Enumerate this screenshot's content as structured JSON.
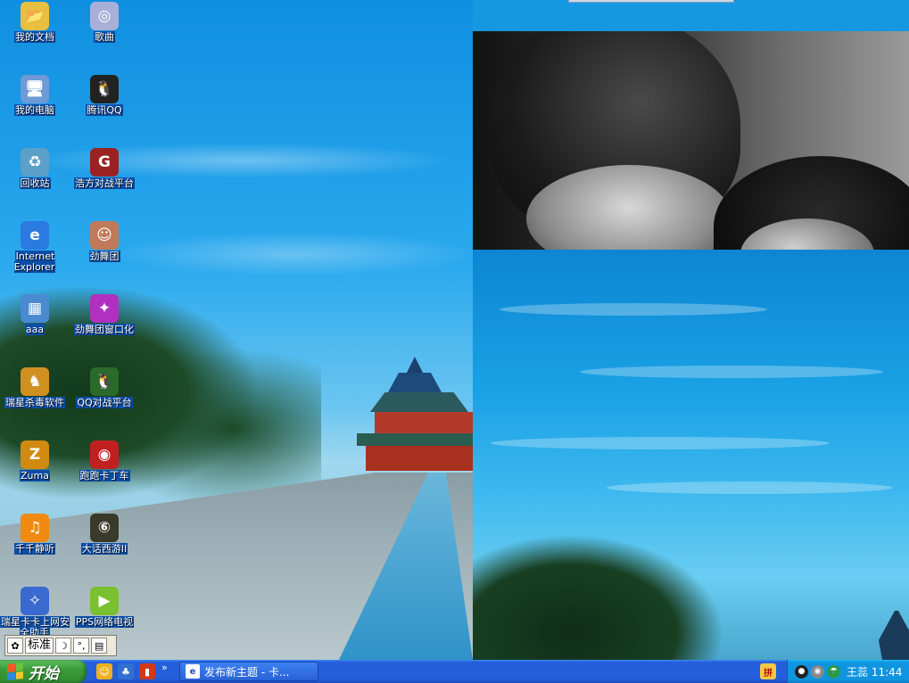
{
  "desktop": {
    "icons": [
      {
        "label": "我的文档",
        "glyph": "📂",
        "icon": "folder-icon",
        "color": "#e8c040"
      },
      {
        "label": "歌曲",
        "glyph": "◎",
        "icon": "cd-icon",
        "color": "#a8b0d8"
      },
      {
        "label": "我的电脑",
        "glyph": "🖥",
        "icon": "computer-icon",
        "color": "#6e9ad6"
      },
      {
        "label": "腾讯QQ",
        "glyph": "🐧",
        "icon": "qq-penguin-icon",
        "color": "#222222"
      },
      {
        "label": "回收站",
        "glyph": "♻",
        "icon": "recycle-bin-icon",
        "color": "#5aa0c8"
      },
      {
        "label": "浩方对战平台",
        "glyph": "G",
        "icon": "game-icon",
        "color": "#9a2222"
      },
      {
        "label": "Internet Explorer",
        "glyph": "e",
        "icon": "internet-explorer-icon",
        "color": "#2a7ae0"
      },
      {
        "label": "劲舞团",
        "glyph": "☺",
        "icon": "dance-game-avatar-icon",
        "color": "#c07a5a"
      },
      {
        "label": "aaa",
        "glyph": "▦",
        "icon": "network-computer-icon",
        "color": "#4a8ad0"
      },
      {
        "label": "劲舞团窗口化",
        "glyph": "✦",
        "icon": "dance-window-icon",
        "color": "#b030c0"
      },
      {
        "label": "瑞星杀毒软件",
        "glyph": "♞",
        "icon": "antivirus-lion-icon",
        "color": "#d09020"
      },
      {
        "label": "QQ对战平台",
        "glyph": "🐧",
        "icon": "qq-game-icon",
        "color": "#2a6a2a"
      },
      {
        "label": "Zuma",
        "glyph": "Z",
        "icon": "zuma-icon",
        "color": "#d08a10"
      },
      {
        "label": "跑跑卡丁车",
        "glyph": "◉",
        "icon": "kart-icon",
        "color": "#c02020"
      },
      {
        "label": "千千静听",
        "glyph": "♫",
        "icon": "music-player-icon",
        "color": "#f08a10"
      },
      {
        "label": "大话西游II",
        "glyph": "⑥",
        "icon": "game-disc-icon",
        "color": "#3a3a2a"
      },
      {
        "label": "瑞星卡卡上网安全助手",
        "glyph": "✧",
        "icon": "security-wizard-icon",
        "color": "#3a6ad0"
      },
      {
        "label": "PPS网络电视",
        "glyph": "▶",
        "icon": "pps-tv-icon",
        "color": "#7ac030"
      }
    ]
  },
  "langbar": {
    "mode_label": "标准",
    "icons": [
      "ime-logo-icon",
      "moon-icon",
      "punctuation-icon",
      "keyboard-icon"
    ]
  },
  "taskbar": {
    "start_label": "开始",
    "quicklaunch": [
      {
        "icon": "qq-quicklaunch-icon",
        "color": "#f0b020",
        "glyph": "☺"
      },
      {
        "icon": "qq-game-quicklaunch-icon",
        "color": "#3070d0",
        "glyph": "♣"
      },
      {
        "icon": "app-quicklaunch-icon",
        "color": "#d03a1a",
        "glyph": "▮"
      }
    ],
    "chevron": "»",
    "task_label": "发布新主题 - 卡...",
    "clock": "王蕊 11:44"
  },
  "colors": {
    "taskbar_blue": "#245edb",
    "start_green": "#3a9d3a",
    "tray_blue": "#0f94e0",
    "label_highlight": "#0b4ea8"
  }
}
